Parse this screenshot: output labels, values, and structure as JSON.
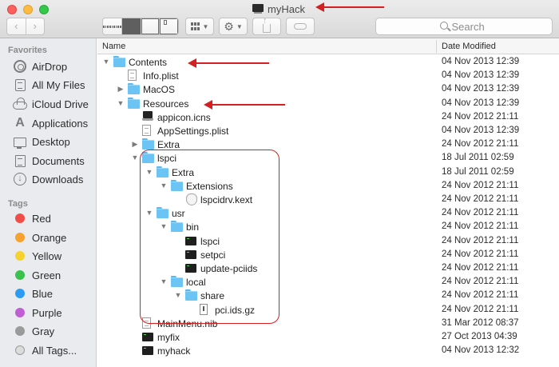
{
  "window": {
    "title": "myHack",
    "title_icon": "terminal-doc-icon"
  },
  "toolbar": {
    "back_glyph": "‹",
    "forward_glyph": "›",
    "view_modes": [
      "icon-view",
      "list-view",
      "column-view",
      "coverflow-view"
    ],
    "active_view": "list-view",
    "arrange_icon": "arrange-grid-icon",
    "action_icon": "gear-icon",
    "action_glyph": "⚙",
    "share_icon": "share-icon",
    "tag_icon": "tag-icon",
    "search_placeholder": "Search"
  },
  "sidebar": {
    "favorites_header": "Favorites",
    "favorites": [
      {
        "label": "AirDrop",
        "icon": "airdrop-icon"
      },
      {
        "label": "All My Files",
        "icon": "all-files-icon"
      },
      {
        "label": "iCloud Drive",
        "icon": "cloud-icon"
      },
      {
        "label": "Applications",
        "icon": "applications-icon"
      },
      {
        "label": "Desktop",
        "icon": "desktop-icon"
      },
      {
        "label": "Documents",
        "icon": "documents-icon"
      },
      {
        "label": "Downloads",
        "icon": "downloads-icon"
      }
    ],
    "tags_header": "Tags",
    "tags": [
      {
        "label": "Red",
        "color": "#f24c48"
      },
      {
        "label": "Orange",
        "color": "#f7a22f"
      },
      {
        "label": "Yellow",
        "color": "#f5d22c"
      },
      {
        "label": "Green",
        "color": "#39c34c"
      },
      {
        "label": "Blue",
        "color": "#2c9cf2"
      },
      {
        "label": "Purple",
        "color": "#c05ed6"
      },
      {
        "label": "Gray",
        "color": "#9a9a9a"
      },
      {
        "label": "All Tags...",
        "color": "#dcdcdc"
      }
    ]
  },
  "columns": {
    "name": "Name",
    "date": "Date Modified"
  },
  "files": [
    {
      "name": "Contents",
      "date": "04 Nov 2013 12:39",
      "type": "folder",
      "level": 0,
      "disclosure": "open"
    },
    {
      "name": "Info.plist",
      "date": "04 Nov 2013 12:39",
      "type": "doc",
      "level": 1,
      "disclosure": "none"
    },
    {
      "name": "MacOS",
      "date": "04 Nov 2013 12:39",
      "type": "folder",
      "level": 1,
      "disclosure": "closed"
    },
    {
      "name": "Resources",
      "date": "04 Nov 2013 12:39",
      "type": "folder",
      "level": 1,
      "disclosure": "open"
    },
    {
      "name": "appicon.icns",
      "date": "24 Nov 2012 21:11",
      "type": "icns",
      "level": 2,
      "disclosure": "none"
    },
    {
      "name": "AppSettings.plist",
      "date": "04 Nov 2013 12:39",
      "type": "doc",
      "level": 2,
      "disclosure": "none"
    },
    {
      "name": "Extra",
      "date": "24 Nov 2012 21:11",
      "type": "folder",
      "level": 2,
      "disclosure": "closed"
    },
    {
      "name": "lspci",
      "date": "18 Jul 2011 02:59",
      "type": "folder",
      "level": 2,
      "disclosure": "open"
    },
    {
      "name": "Extra",
      "date": "18 Jul 2011 02:59",
      "type": "folder",
      "level": 3,
      "disclosure": "open"
    },
    {
      "name": "Extensions",
      "date": "24 Nov 2012 21:11",
      "type": "folder",
      "level": 4,
      "disclosure": "open"
    },
    {
      "name": "lspcidrv.kext",
      "date": "24 Nov 2012 21:11",
      "type": "kext",
      "level": 5,
      "disclosure": "none"
    },
    {
      "name": "usr",
      "date": "24 Nov 2012 21:11",
      "type": "folder",
      "level": 3,
      "disclosure": "open"
    },
    {
      "name": "bin",
      "date": "24 Nov 2012 21:11",
      "type": "folder",
      "level": 4,
      "disclosure": "open"
    },
    {
      "name": "lspci",
      "date": "24 Nov 2012 21:11",
      "type": "terminal",
      "level": 5,
      "disclosure": "none"
    },
    {
      "name": "setpci",
      "date": "24 Nov 2012 21:11",
      "type": "terminal",
      "level": 5,
      "disclosure": "none"
    },
    {
      "name": "update-pciids",
      "date": "24 Nov 2012 21:11",
      "type": "terminal",
      "level": 5,
      "disclosure": "none"
    },
    {
      "name": "local",
      "date": "24 Nov 2012 21:11",
      "type": "folder",
      "level": 4,
      "disclosure": "open"
    },
    {
      "name": "share",
      "date": "24 Nov 2012 21:11",
      "type": "folder",
      "level": 5,
      "disclosure": "open"
    },
    {
      "name": "pci.ids.gz",
      "date": "24 Nov 2012 21:11",
      "type": "gz",
      "level": 6,
      "disclosure": "none"
    },
    {
      "name": "MainMenu.nib",
      "date": "31 Mar 2012 08:37",
      "type": "doc",
      "level": 2,
      "disclosure": "none"
    },
    {
      "name": "myfix",
      "date": "27 Oct 2013 04:39",
      "type": "terminal",
      "level": 2,
      "disclosure": "none"
    },
    {
      "name": "myhack",
      "date": "04 Nov 2013 12:32",
      "type": "terminal",
      "level": 2,
      "disclosure": "none"
    }
  ],
  "annotation": {
    "color": "#d42020",
    "arrows_point_to": [
      "window-title",
      "Contents",
      "Resources"
    ],
    "highlighted_folder": "lspci"
  }
}
